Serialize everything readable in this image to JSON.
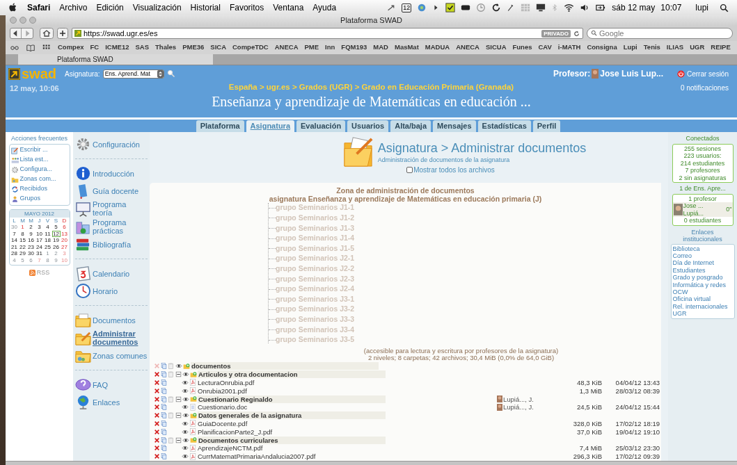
{
  "menubar": {
    "app": "Safari",
    "menus": [
      "Archivo",
      "Edición",
      "Visualización",
      "Historial",
      "Favoritos",
      "Ventana",
      "Ayuda"
    ],
    "badge": "12",
    "date": "sáb 12 may",
    "time": "10:07",
    "user": "lupi"
  },
  "browser": {
    "title": "Plataforma SWAD",
    "url": "https://swad.ugr.es/es",
    "private_badge": "PRIVADO",
    "search": {
      "placeholder": "Google"
    },
    "bookmarks": [
      "Compex",
      "FC",
      "ICME12",
      "SAS",
      "Thales",
      "PME36",
      "SICA",
      "CompeTDC",
      "ANECA",
      "PME",
      "Inn",
      "FQM193",
      "MAD",
      "MasMat",
      "MADUA",
      "ANECA",
      "SICUA",
      "Funes",
      "CAV",
      "i-MATH",
      "Consigna",
      "Lupi",
      "Tenis",
      "ILIAS",
      "UGR",
      "REIPE"
    ],
    "tabs": [
      {
        "label": "Plataforma SWAD",
        "selected": true
      }
    ]
  },
  "header": {
    "logo": "swad",
    "course_label": "Asignatura:",
    "course_select": "Ens. Aprend. Mat",
    "date": "12 may, 10:06",
    "breadcrumb": "España > ugr.es > Grados (UGR) > Grado en Educación Primaria (Granada)",
    "title": "Enseñanza y aprendizaje de Matemáticas en educación ...",
    "user_label": "Profesor:",
    "user_name": "Jose Luis Lup...",
    "logout": "Cerrar sesión",
    "notifications": "0 notificaciones"
  },
  "tabs": [
    {
      "label": "Plataforma",
      "selected": false
    },
    {
      "label": "Asignatura",
      "selected": true
    },
    {
      "label": "Evaluación",
      "selected": false
    },
    {
      "label": "Usuarios",
      "selected": false
    },
    {
      "label": "Alta/baja",
      "selected": false
    },
    {
      "label": "Mensajes",
      "selected": false
    },
    {
      "label": "Estadísticas",
      "selected": false
    },
    {
      "label": "Perfil",
      "selected": false
    }
  ],
  "frequent": {
    "title": "Acciones frecuentes",
    "items": [
      "Escribir ...",
      "Lista est...",
      "Configura...",
      "Zonas com...",
      "Recibidos",
      "Grupos"
    ]
  },
  "calendar": {
    "month": "MAYO 2012",
    "weekdays": [
      {
        "label": "L",
        "holiday": false
      },
      {
        "label": "M",
        "holiday": false
      },
      {
        "label": "M",
        "holiday": false
      },
      {
        "label": "J",
        "holiday": false
      },
      {
        "label": "V",
        "holiday": false
      },
      {
        "label": "S",
        "holiday": false
      },
      {
        "label": "D",
        "holiday": true
      }
    ],
    "weeks": [
      [
        {
          "day": "30",
          "muted": true,
          "holiday": false,
          "today": false
        },
        {
          "day": "1",
          "muted": false,
          "holiday": true,
          "today": false
        },
        {
          "day": "2",
          "muted": false,
          "holiday": false,
          "today": false
        },
        {
          "day": "3",
          "muted": false,
          "holiday": false,
          "today": false
        },
        {
          "day": "4",
          "muted": false,
          "holiday": false,
          "today": false
        },
        {
          "day": "5",
          "muted": false,
          "holiday": false,
          "today": false
        },
        {
          "day": "6",
          "muted": false,
          "holiday": true,
          "today": false
        }
      ],
      [
        {
          "day": "7",
          "muted": false,
          "holiday": false,
          "today": false
        },
        {
          "day": "8",
          "muted": false,
          "holiday": false,
          "today": false
        },
        {
          "day": "9",
          "muted": false,
          "holiday": false,
          "today": false
        },
        {
          "day": "10",
          "muted": false,
          "holiday": false,
          "today": false
        },
        {
          "day": "11",
          "muted": false,
          "holiday": false,
          "today": false
        },
        {
          "day": "12",
          "muted": false,
          "holiday": false,
          "today": true
        },
        {
          "day": "13",
          "muted": false,
          "holiday": true,
          "today": false
        }
      ],
      [
        {
          "day": "14",
          "muted": false,
          "holiday": false,
          "today": false
        },
        {
          "day": "15",
          "muted": false,
          "holiday": false,
          "today": false
        },
        {
          "day": "16",
          "muted": false,
          "holiday": false,
          "today": false
        },
        {
          "day": "17",
          "muted": false,
          "holiday": false,
          "today": false
        },
        {
          "day": "18",
          "muted": false,
          "holiday": false,
          "today": false
        },
        {
          "day": "19",
          "muted": false,
          "holiday": false,
          "today": false
        },
        {
          "day": "20",
          "muted": false,
          "holiday": true,
          "today": false
        }
      ],
      [
        {
          "day": "21",
          "muted": false,
          "holiday": false,
          "today": false
        },
        {
          "day": "22",
          "muted": false,
          "holiday": false,
          "today": false
        },
        {
          "day": "23",
          "muted": false,
          "holiday": false,
          "today": false
        },
        {
          "day": "24",
          "muted": false,
          "holiday": false,
          "today": false
        },
        {
          "day": "25",
          "muted": false,
          "holiday": false,
          "today": false
        },
        {
          "day": "26",
          "muted": false,
          "holiday": false,
          "today": false
        },
        {
          "day": "27",
          "muted": false,
          "holiday": true,
          "today": false
        }
      ],
      [
        {
          "day": "28",
          "muted": false,
          "holiday": false,
          "today": false
        },
        {
          "day": "29",
          "muted": false,
          "holiday": false,
          "today": false
        },
        {
          "day": "30",
          "muted": false,
          "holiday": false,
          "today": false
        },
        {
          "day": "31",
          "muted": false,
          "holiday": false,
          "today": false
        },
        {
          "day": "1",
          "muted": true,
          "holiday": false,
          "today": false
        },
        {
          "day": "2",
          "muted": true,
          "holiday": false,
          "today": false
        },
        {
          "day": "3",
          "muted": true,
          "holiday": true,
          "today": false
        }
      ],
      [
        {
          "day": "4",
          "muted": true,
          "holiday": false,
          "today": false
        },
        {
          "day": "5",
          "muted": true,
          "holiday": false,
          "today": false
        },
        {
          "day": "6",
          "muted": true,
          "holiday": false,
          "today": false
        },
        {
          "day": "7",
          "muted": true,
          "holiday": true,
          "today": false
        },
        {
          "day": "8",
          "muted": true,
          "holiday": false,
          "today": false
        },
        {
          "day": "9",
          "muted": true,
          "holiday": false,
          "today": false
        },
        {
          "day": "10",
          "muted": true,
          "holiday": true,
          "today": false
        }
      ]
    ]
  },
  "rss": "RSS",
  "menu": [
    [
      {
        "label": "Configuración",
        "selected": false
      }
    ],
    [
      {
        "label": "Introducción",
        "selected": false
      },
      {
        "label": "Guía docente",
        "selected": false
      },
      {
        "label": "Programa teoría",
        "selected": false
      },
      {
        "label": "Programa prácticas",
        "selected": false
      },
      {
        "label": "Bibliografía",
        "selected": false
      }
    ],
    [
      {
        "label": "Calendario",
        "selected": false
      },
      {
        "label": "Horario",
        "selected": false
      }
    ],
    [
      {
        "label": "Documentos",
        "selected": false
      },
      {
        "label": "Administrar documentos",
        "selected": true
      },
      {
        "label": "Zonas comunes",
        "selected": false
      }
    ],
    [
      {
        "label": "FAQ",
        "selected": false
      },
      {
        "label": "Enlaces",
        "selected": false
      }
    ]
  ],
  "main": {
    "title": "Asignatura > Administrar documentos",
    "subtitle": "Administración de documentos de la asignatura",
    "show_all": {
      "label": "Mostrar todos los archivos",
      "checked": false
    },
    "zone_title": "Zona de administración de documentos",
    "zone_subtitle": "asignatura Enseñanza y aprendizaje de Matemáticas en educación primaria (J)",
    "groups": [
      {
        "label": "grupo Seminarios J1-1",
        "disabled": true
      },
      {
        "label": "grupo Seminarios J1-2",
        "disabled": true
      },
      {
        "label": "grupo Seminarios J1-3",
        "disabled": true
      },
      {
        "label": "grupo Seminarios J1-4",
        "disabled": true
      },
      {
        "label": "grupo Seminarios J1-5",
        "disabled": true
      },
      {
        "label": "grupo Seminarios J2-1",
        "disabled": true
      },
      {
        "label": "grupo Seminarios J2-2",
        "disabled": true
      },
      {
        "label": "grupo Seminarios J2-3",
        "disabled": true
      },
      {
        "label": "grupo Seminarios J2-4",
        "disabled": true
      },
      {
        "label": "grupo Seminarios J3-1",
        "disabled": true
      },
      {
        "label": "grupo Seminarios J3-2",
        "disabled": true
      },
      {
        "label": "grupo Seminarios J3-3",
        "disabled": true
      },
      {
        "label": "grupo Seminarios J3-4",
        "disabled": true
      },
      {
        "label": "grupo Seminarios J3-5",
        "disabled": true
      }
    ],
    "access_note": "(accesible para lectura y escritura por profesores de la asignatura)",
    "stats": "2 niveles; 8 carpetas; 42 archivos; 30,4 MiB (0,0% de 64,0 GiB)",
    "tree": [
      {
        "kind": "folder",
        "name": "documentos",
        "removable": false,
        "children": [
          {
            "kind": "folder",
            "name": "Articulos y otra documentacion",
            "removable": true,
            "expanded": true,
            "children": [
              {
                "kind": "pdf",
                "name": "LecturaOnrubia.pdf",
                "removable": true,
                "size": "48,3 KiB",
                "date": "04/04/12 13:43"
              },
              {
                "kind": "pdf",
                "name": "Onrubia2001.pdf",
                "removable": true,
                "size": "1,3 MiB",
                "date": "28/03/12 08:39"
              }
            ]
          },
          {
            "kind": "folder",
            "name": "Cuestionario Reginaldo",
            "removable": true,
            "expanded": true,
            "author": "Lupiá..., J.",
            "children": [
              {
                "kind": "doc",
                "name": "Cuestionario.doc",
                "removable": true,
                "author": "Lupiá..., J.",
                "size": "24,5 KiB",
                "date": "24/04/12 15:44"
              }
            ]
          },
          {
            "kind": "folder",
            "name": "Datos generales de la asignatura",
            "removable": true,
            "expanded": true,
            "children": [
              {
                "kind": "pdf",
                "name": "GuiaDocente.pdf",
                "removable": true,
                "size": "328,0 KiB",
                "date": "17/02/12 18:19"
              },
              {
                "kind": "pdf",
                "name": "PlanificacionParte2_J.pdf",
                "removable": true,
                "size": "37,0 KiB",
                "date": "19/04/12 19:10"
              }
            ]
          },
          {
            "kind": "folder",
            "name": "Documentos curriculares",
            "removable": true,
            "expanded": true,
            "children": [
              {
                "kind": "pdf",
                "name": "AprendizajeNCTM.pdf",
                "removable": true,
                "size": "7,4 MiB",
                "date": "25/03/12 23:30"
              },
              {
                "kind": "pdf",
                "name": "CurrMatematPrimariaAndalucia2007.pdf",
                "removable": true,
                "size": "296,3 KiB",
                "date": "17/02/12 09:39"
              }
            ]
          }
        ]
      }
    ]
  },
  "connected": {
    "title": "Conectados",
    "stats": [
      "255 sesiones",
      "223 usuarios:",
      "214 estudiantes",
      "7 profesores",
      "2 sin asignaturas"
    ],
    "course": "1 de Ens. Apre...",
    "teachers": "1 profesor",
    "user_first": "Jose ...",
    "user_last": "Lupiá...",
    "user_time": "0\"",
    "students": "0 estudiantes"
  },
  "links": {
    "title": "Enlaces institucionales",
    "items": [
      "Biblioteca",
      "Correo",
      "Día de Internet",
      "Estudiantes",
      "Grado y posgrado",
      "Informática y redes",
      "OCW",
      "Oficina virtual",
      "Rel. internacionales",
      "UGR"
    ]
  }
}
